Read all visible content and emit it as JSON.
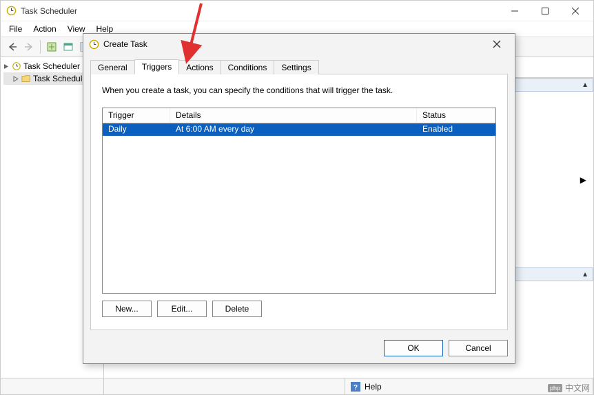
{
  "main": {
    "title": "Task Scheduler",
    "menus": {
      "file": "File",
      "action": "Action",
      "view": "View",
      "help": "Help"
    },
    "tree": {
      "root": "Task Scheduler (L",
      "child": "Task Schedule"
    },
    "status_help": "Help"
  },
  "actions_panel": {
    "scroll1_up": "▲",
    "scroll2_up": "▲",
    "expand_right": "▶"
  },
  "dialog": {
    "title": "Create Task",
    "tabs": {
      "general": "General",
      "triggers": "Triggers",
      "actions": "Actions",
      "conditions": "Conditions",
      "settings": "Settings"
    },
    "triggers_page": {
      "desc": "When you create a task, you can specify the conditions that will trigger the task.",
      "columns": {
        "trigger": "Trigger",
        "details": "Details",
        "status": "Status"
      },
      "rows": [
        {
          "trigger": "Daily",
          "details": "At 6:00 AM every day",
          "status": "Enabled"
        }
      ],
      "buttons": {
        "new": "New...",
        "edit": "Edit...",
        "delete": "Delete"
      }
    },
    "footer": {
      "ok": "OK",
      "cancel": "Cancel"
    }
  },
  "watermark": {
    "php": "php",
    "text": "中文网"
  }
}
